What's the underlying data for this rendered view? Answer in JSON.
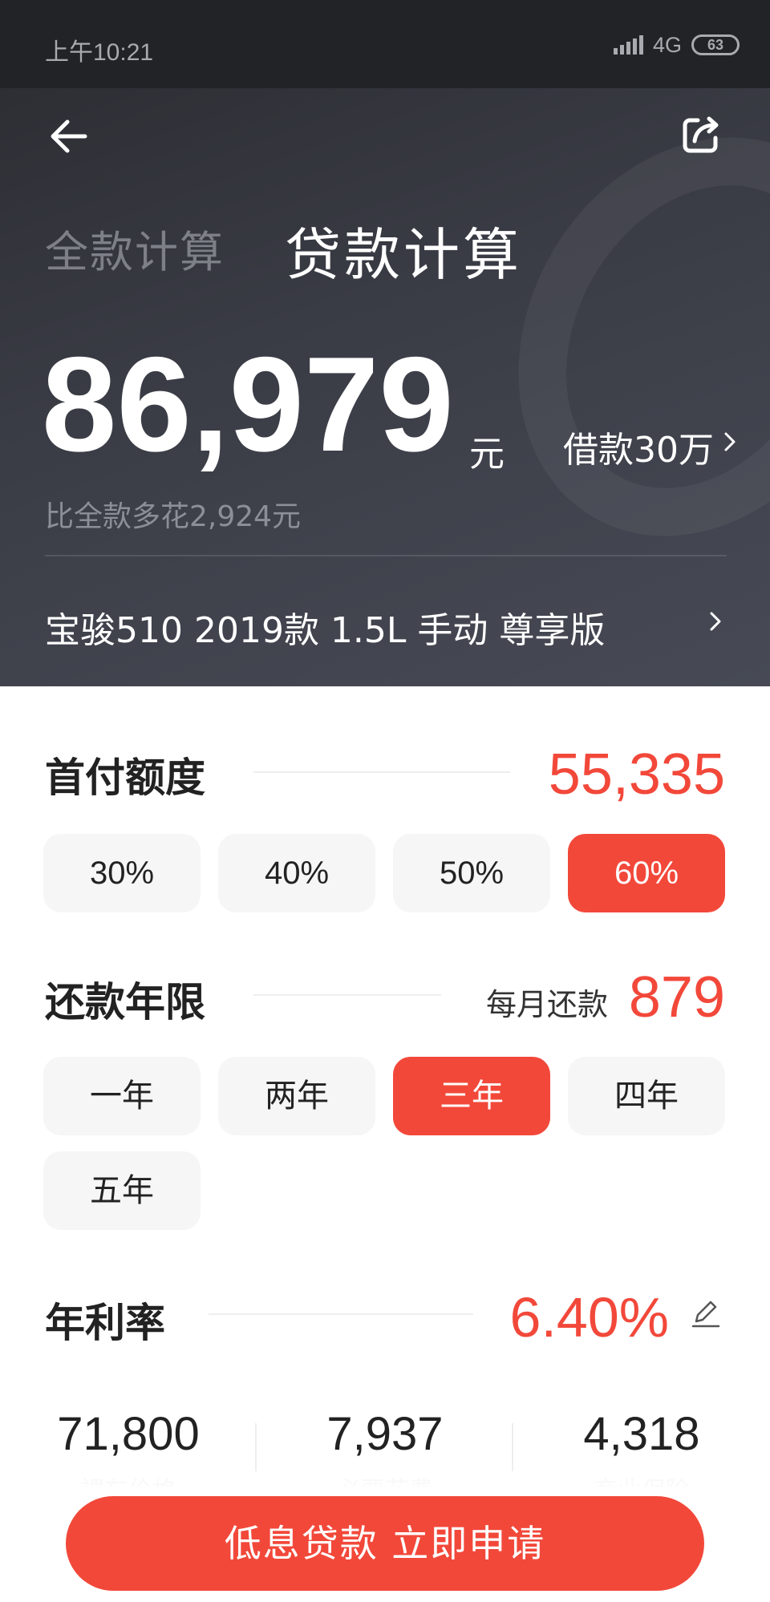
{
  "status_bar": {
    "time": "上午10:21",
    "network": "4G",
    "battery": "63"
  },
  "header": {
    "tab_full": "全款计算",
    "tab_loan": "贷款计算",
    "total_amount": "86,979",
    "amount_unit": "元",
    "loan_link": "借款30万",
    "extra_cost": "比全款多花2,924元",
    "car_model": "宝骏510 2019款 1.5L 手动 尊享版"
  },
  "down_payment": {
    "title": "首付额度",
    "value": "55,335",
    "options": [
      "30%",
      "40%",
      "50%",
      "60%"
    ],
    "selected": "60%"
  },
  "term": {
    "title": "还款年限",
    "monthly_label": "每月还款",
    "monthly_value": "879",
    "options": [
      "一年",
      "两年",
      "三年",
      "四年",
      "五年"
    ],
    "selected": "三年"
  },
  "rate": {
    "title": "年利率",
    "value": "6.40%"
  },
  "stats": [
    {
      "value": "71,800",
      "label": "裸车价格"
    },
    {
      "value": "7,937",
      "label": "必要花费"
    },
    {
      "value": "4,318",
      "label": "商业保险"
    }
  ],
  "apply_button": "低息贷款 立即申请",
  "colors": {
    "accent": "#f2483a",
    "header_bg": "#3a3c45"
  }
}
